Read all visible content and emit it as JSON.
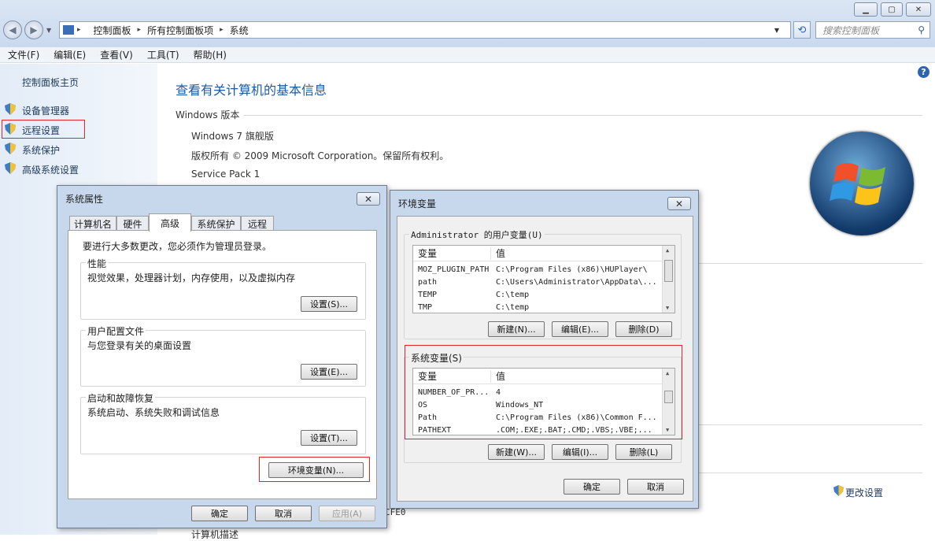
{
  "window": {
    "minimize": "▭",
    "maximize": "▢",
    "close": "✕"
  },
  "breadcrumb": [
    "控制面板",
    "所有控制面板项",
    "系统"
  ],
  "search": {
    "placeholder": "搜索控制面板"
  },
  "menu": [
    "文件(F)",
    "编辑(E)",
    "查看(V)",
    "工具(T)",
    "帮助(H)"
  ],
  "leftnav": {
    "home": "控制面板主页",
    "items": [
      "设备管理器",
      "远程设置",
      "系统保护",
      "高级系统设置"
    ]
  },
  "main": {
    "title": "查看有关计算机的基本信息",
    "edition_heading": "Windows 版本",
    "edition": "Windows 7 旗舰版",
    "copyright": "版权所有 © 2009 Microsoft Corporation。保留所有权利。",
    "service_pack": "Service Pack 1",
    "change_settings": "更改设置",
    "partial_cfe": "CFE0",
    "partial_bottom": "计算机描述"
  },
  "sysprops": {
    "title": "系统属性",
    "close": "✕",
    "tabs": [
      "计算机名",
      "硬件",
      "高级",
      "系统保护",
      "远程"
    ],
    "admin_note": "要进行大多数更改，您必须作为管理员登录。",
    "perf": {
      "title": "性能",
      "desc": "视觉效果，处理器计划，内存使用，以及虚拟内存",
      "button": "设置(S)..."
    },
    "profile": {
      "title": "用户配置文件",
      "desc": "与您登录有关的桌面设置",
      "button": "设置(E)..."
    },
    "startup": {
      "title": "启动和故障恢复",
      "desc": "系统启动、系统失败和调试信息",
      "button": "设置(T)..."
    },
    "env_button": "环境变量(N)...",
    "ok": "确定",
    "cancel": "取消",
    "apply": "应用(A)"
  },
  "envvars": {
    "title": "环境变量",
    "close": "✕",
    "user_group": "Administrator 的用户变量(U)",
    "col_var": "变量",
    "col_val": "值",
    "user_rows": [
      {
        "name": "MOZ_PLUGIN_PATH",
        "value": "C:\\Program Files (x86)\\HUPlayer\\"
      },
      {
        "name": "path",
        "value": "C:\\Users\\Administrator\\AppData\\..."
      },
      {
        "name": "TEMP",
        "value": "C:\\temp"
      },
      {
        "name": "TMP",
        "value": "C:\\temp"
      }
    ],
    "user_buttons": [
      "新建(N)...",
      "编辑(E)...",
      "删除(D)"
    ],
    "sys_group": "系统变量(S)",
    "sys_rows": [
      {
        "name": "NUMBER_OF_PR...",
        "value": "4"
      },
      {
        "name": "OS",
        "value": "Windows_NT"
      },
      {
        "name": "Path",
        "value": "C:\\Program Files (x86)\\Common F..."
      },
      {
        "name": "PATHEXT",
        "value": ".COM;.EXE;.BAT;.CMD;.VBS;.VBE;..."
      }
    ],
    "sys_buttons": [
      "新建(W)...",
      "编辑(I)...",
      "删除(L)"
    ],
    "ok": "确定",
    "cancel": "取消"
  },
  "colors": {
    "accent": "#1e5aa6",
    "highlight": "#e0262a"
  }
}
